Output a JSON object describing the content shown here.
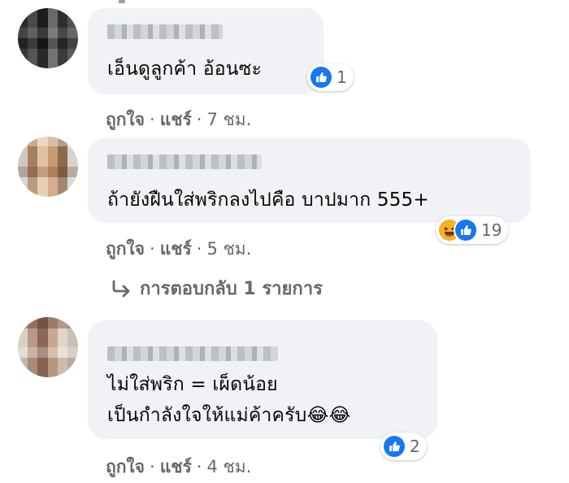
{
  "comments": [
    {
      "text_lines": [
        "เอ็นดูลูกค้า อ้อนซะ"
      ],
      "reactions": {
        "types": [
          "like-icon"
        ],
        "count": "1"
      },
      "actions": {
        "like": "ถูกใจ",
        "share": "แชร์",
        "time": "7 ชม."
      }
    },
    {
      "text_lines": [
        "ถ้ายังฝืนใส่พริกลงไปคือ บาปมาก 555+"
      ],
      "reactions": {
        "types": [
          "haha-icon",
          "like-icon"
        ],
        "count": "19"
      },
      "actions": {
        "like": "ถูกใจ",
        "share": "แชร์",
        "time": "5 ชม."
      },
      "replies_label": "การตอบกลับ 1 รายการ"
    },
    {
      "text_lines": [
        "ไม่ใส่พริก = เผ็ดน้อย",
        "เป็นกำลังใจให้แม่ค้าครับ😂😂"
      ],
      "reactions": {
        "types": [
          "like-icon"
        ],
        "count": "2"
      },
      "actions": {
        "like": "ถูกใจ",
        "share": "แชร์",
        "time": "4 ชม."
      }
    }
  ],
  "colors": {
    "bubble": "#f0f2f5",
    "like": "#1877f2",
    "haha": "#f7b125",
    "meta_text": "#65676b"
  }
}
